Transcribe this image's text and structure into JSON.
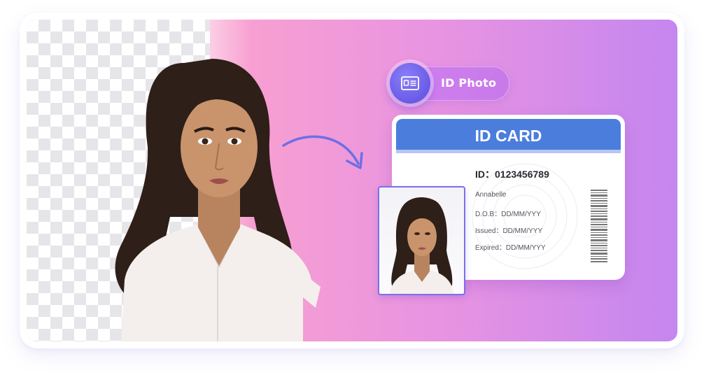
{
  "pill": {
    "label": "ID Photo",
    "icon": "id-card-icon"
  },
  "card": {
    "title": "ID CARD",
    "id_line": "ID：0123456789",
    "name": "Annabelle",
    "dob": "D.O.B：DD/MM/YYY",
    "issued": "Issued：DD/MM/YYY",
    "expired": "Expired：DD/MM/YYY"
  },
  "colors": {
    "card_header": "#4b7ddd",
    "pill_icon": "#6a5ce8",
    "gradient_start": "#ff98b4",
    "gradient_end": "#c486ef"
  },
  "icons": {
    "arrow": "curved-arrow-icon",
    "barcode": "barcode-icon"
  }
}
